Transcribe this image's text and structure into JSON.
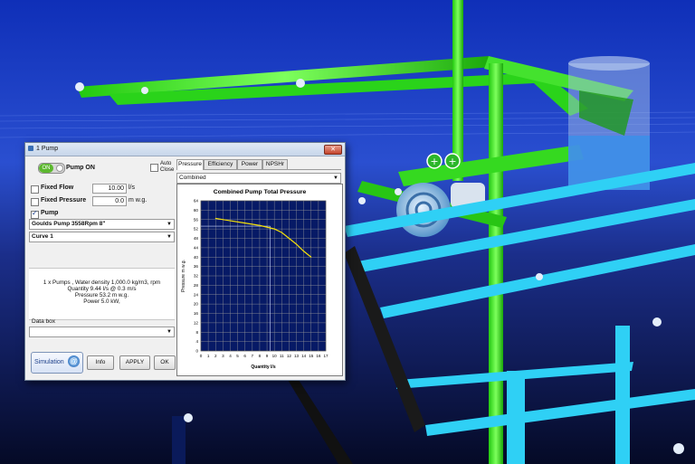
{
  "dialog": {
    "title": "1 Pump",
    "close_label": "✕",
    "pump_on": {
      "switch_label": "ON",
      "label": "Pump ON",
      "on": true
    },
    "auto_close": {
      "line1": "Auto",
      "line2": "Close",
      "checked": false
    },
    "fixed_flow": {
      "label": "Fixed Flow",
      "value": "10.00",
      "unit": "l/s",
      "checked": false
    },
    "fixed_pressure": {
      "label": "Fixed Pressure",
      "value": "0.0",
      "unit": "m w.g.",
      "checked": false
    },
    "pump": {
      "label": "Pump",
      "checked": true,
      "model": "Goulds Pump 3558Rpm 8\"",
      "curve": "Curve 1"
    },
    "info_lines": [
      "1 x Pumps ,  Water density   1,000.0 kg/m3,  rpm",
      "Quantity  9.44 l/s @  0.3 m/s",
      "Pressure 53.2 m w.g.",
      "Power  5.0 kW,"
    ],
    "data_box_label": "Data box",
    "buttons": {
      "simulation": "Simulation",
      "info": "Info",
      "apply": "APPLY",
      "ok": "OK"
    }
  },
  "tabs": [
    "Pressure",
    "Efficiency",
    "Power",
    "NPSHr"
  ],
  "active_tab": "Pressure",
  "combined_select": "Combined",
  "chart_data": {
    "type": "line",
    "title": "Combined Pump Total Pressure",
    "xlabel": "Quantity l/s",
    "ylabel": "Pressure m w.g.",
    "xlim": [
      0,
      17
    ],
    "ylim": [
      0,
      64
    ],
    "x_ticks": [
      0,
      1,
      2,
      3,
      4,
      5,
      6,
      7,
      8,
      9,
      10,
      11,
      12,
      13,
      14,
      15,
      16,
      17
    ],
    "y_ticks": [
      0,
      4,
      8,
      12,
      16,
      20,
      24,
      28,
      32,
      36,
      40,
      44,
      48,
      52,
      56,
      60,
      64
    ],
    "grid": true,
    "plot_bg": "#071a66",
    "grid_color": "#9a9a9a",
    "curve_color": "#f5e10a",
    "series": [
      {
        "x": [
          2,
          4,
          6,
          8,
          10,
          11,
          12,
          13,
          14,
          15
        ],
        "y": [
          56.5,
          55.5,
          54.5,
          53.5,
          52,
          50.5,
          48,
          45.5,
          42.5,
          40
        ]
      }
    ],
    "operating_point": {
      "x": 9.44,
      "y": 53.2
    }
  },
  "colors": {
    "accent": "#3a6fb5",
    "switch_on": "#5cb82e"
  }
}
